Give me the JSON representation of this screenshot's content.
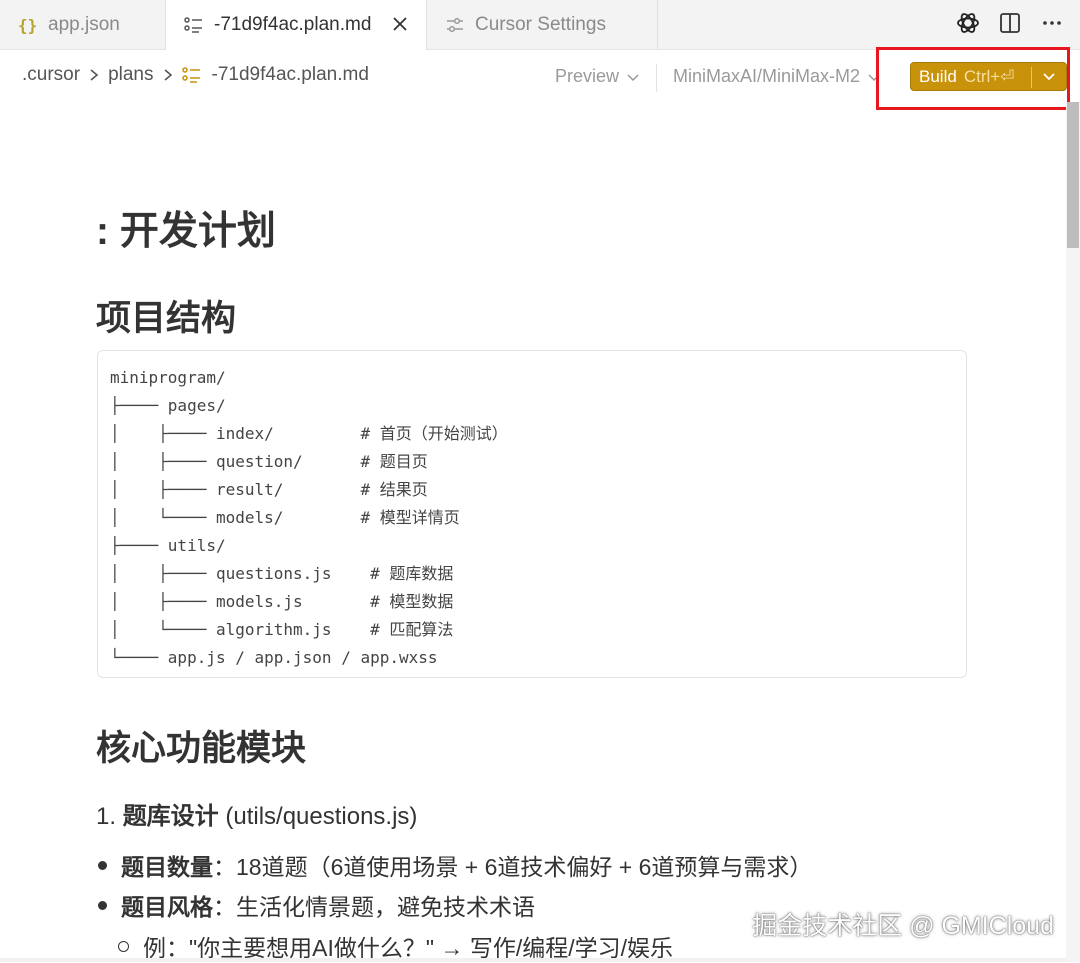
{
  "tabs": [
    {
      "label": "app.json",
      "icon": "json-braces-icon"
    },
    {
      "label": "-71d9f4ac.plan.md",
      "icon": "plan-list-icon",
      "active": true
    },
    {
      "label": "Cursor Settings",
      "icon": "settings-sliders-icon"
    }
  ],
  "breadcrumb": {
    "parts": [
      ".cursor",
      "plans",
      "-71d9f4ac.plan.md"
    ]
  },
  "toolbar": {
    "preview_label": "Preview",
    "model_label": "MiniMaxAI/MiniMax-M2",
    "build_label": "Build",
    "build_shortcut": "Ctrl+⏎"
  },
  "colors": {
    "build_bg": "#c8920a",
    "highlight": "#e8171d",
    "json_icon": "#b5a32a",
    "plan_icon": "#c8920a"
  },
  "doc": {
    "title": ": 开发计划",
    "section1": "项目结构",
    "code": "miniprogram/\n├──── pages/\n│    ├──── index/         # 首页（开始测试）\n│    ├──── question/      # 题目页\n│    ├──── result/        # 结果页\n│    └──── models/        # 模型详情页\n├──── utils/\n│    ├──── questions.js    # 题库数据\n│    ├──── models.js       # 模型数据\n│    └──── algorithm.js    # 匹配算法\n└──── app.js / app.json / app.wxss",
    "section2": "核心功能模块",
    "sub1_num": "1. ",
    "sub1_title": "题库设计",
    "sub1_path": " (utils/questions.js)",
    "bullets": [
      {
        "label": "题目数量",
        "text": "：18道题（6道使用场景 + 6道技术偏好 + 6道预算与需求）"
      },
      {
        "label": "题目风格",
        "text": "：生活化情景题，避免技术术语"
      }
    ],
    "example": "例：\"你主要想用AI做什么？\" → 写作/编程/学习/娱乐"
  },
  "watermark": "掘金技术社区 @ GMICloud"
}
